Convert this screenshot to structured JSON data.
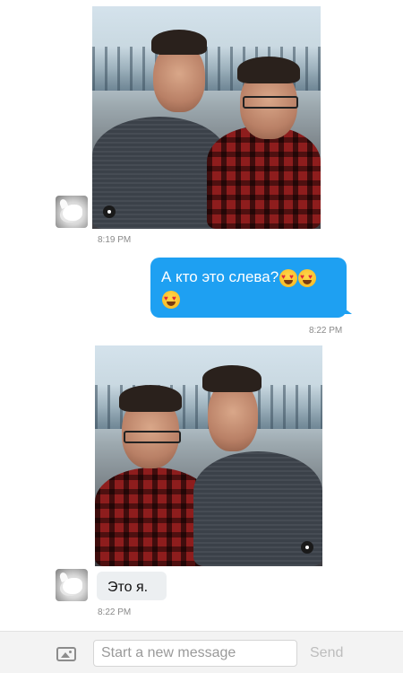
{
  "messages": [
    {
      "type": "image",
      "direction": "incoming",
      "time": "8:19 PM"
    },
    {
      "type": "text",
      "direction": "outgoing",
      "text": "А кто это слева?",
      "emoji": "heart-eyes-emoji",
      "emoji_count": 3,
      "time": "8:22 PM"
    },
    {
      "type": "image",
      "direction": "incoming"
    },
    {
      "type": "text",
      "direction": "incoming",
      "text": "Это я.",
      "time": "8:22 PM"
    }
  ],
  "composer": {
    "placeholder": "Start a new message",
    "send_label": "Send"
  },
  "colors": {
    "sent_bubble": "#1ea0f2",
    "received_bubble": "#eceff1",
    "timestamp": "#8a8a8a"
  }
}
